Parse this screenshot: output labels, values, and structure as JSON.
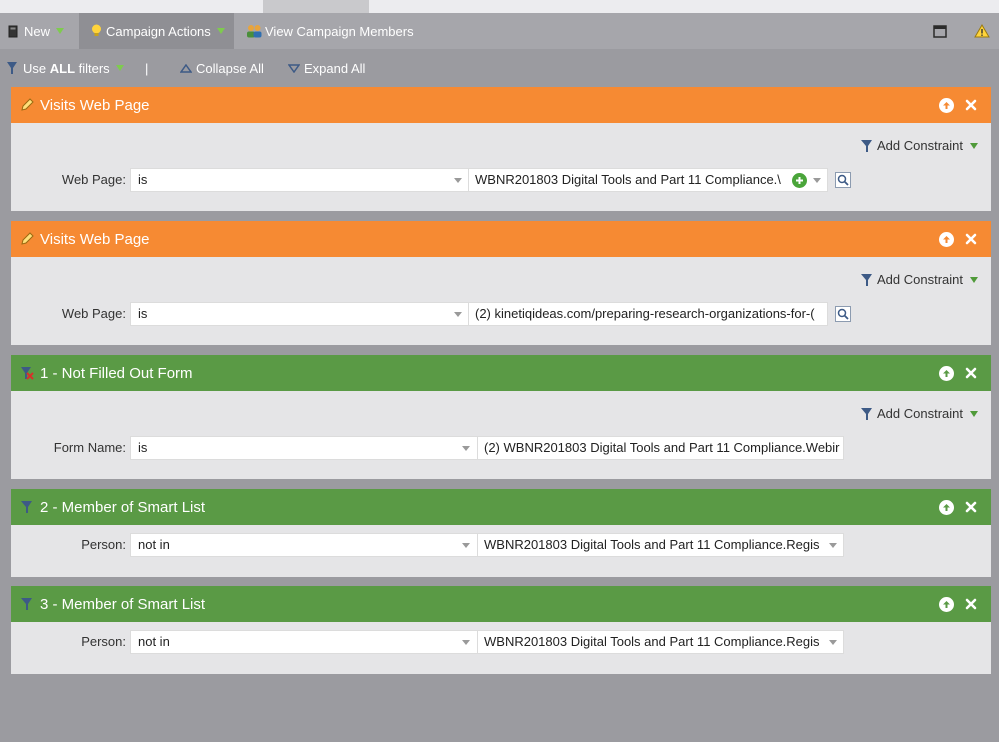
{
  "toolbar": {
    "new_label": "New",
    "campaign_actions_label": "Campaign Actions",
    "view_members_label": "View Campaign Members"
  },
  "filterbar": {
    "use_label_prefix": "Use ",
    "use_label_bold": "ALL",
    "use_label_suffix": " filters",
    "separator": "|",
    "collapse_all": "Collapse All",
    "expand_all": "Expand All"
  },
  "filters": [
    {
      "title": "Visits Web Page",
      "color": "#f68a33",
      "add_constraint": "Add Constraint",
      "field_label": "Web Page:",
      "operator": "is",
      "value": "WBNR201803 Digital Tools and Part 11 Compliance.\\"
    },
    {
      "title": "Visits Web Page",
      "color": "#f68a33",
      "add_constraint": "Add Constraint",
      "field_label": "Web Page:",
      "operator": "is",
      "value": "(2) kinetiqideas.com/preparing-research-organizations-for-("
    },
    {
      "title": "1 - Not Filled Out Form",
      "color": "#5a9a45",
      "add_constraint": "Add Constraint",
      "field_label": "Form Name:",
      "operator": "is",
      "value": "(2) WBNR201803 Digital Tools and Part 11 Compliance.Webir"
    },
    {
      "title": "2 - Member of Smart List",
      "color": "#5a9a45",
      "field_label": "Person:",
      "operator": "not in",
      "value": "WBNR201803 Digital Tools and Part 11 Compliance.Regis"
    },
    {
      "title": "3 - Member of Smart List",
      "color": "#5a9a45",
      "field_label": "Person:",
      "operator": "not in",
      "value": "WBNR201803 Digital Tools and Part 11 Compliance.Regis"
    }
  ]
}
